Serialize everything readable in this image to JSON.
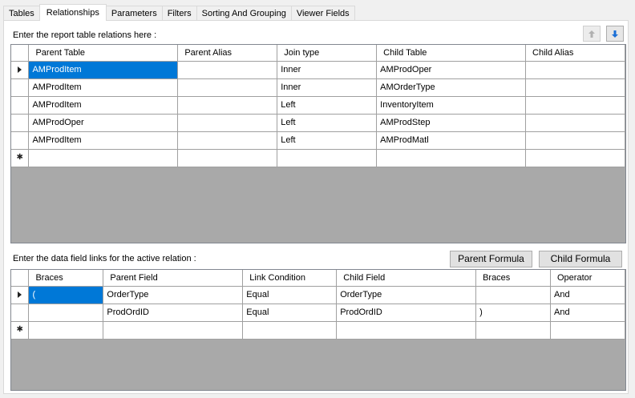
{
  "tabs": [
    "Tables",
    "Relationships",
    "Parameters",
    "Filters",
    "Sorting And Grouping",
    "Viewer Fields"
  ],
  "active_tab": "Relationships",
  "relations": {
    "label": "Enter the report table relations here :",
    "columns": [
      "Parent Table",
      "Parent Alias",
      "Join type",
      "Child Table",
      "Child Alias"
    ],
    "rows": [
      [
        "AMProdItem",
        "",
        "Inner",
        "AMProdOper",
        ""
      ],
      [
        "AMProdItem",
        "",
        "Inner",
        "AMOrderType",
        ""
      ],
      [
        "AMProdItem",
        "",
        "Left",
        "InventoryItem",
        ""
      ],
      [
        "AMProdOper",
        "",
        "Left",
        "AMProdStep",
        ""
      ],
      [
        "AMProdItem",
        "",
        "Left",
        "AMProdMatl",
        ""
      ]
    ],
    "up_icon": "arrow-up-icon",
    "down_icon": "arrow-down-icon"
  },
  "links": {
    "label": "Enter the data field links for the active relation :",
    "parent_formula_label": "Parent Formula",
    "child_formula_label": "Child Formula",
    "columns": [
      "Braces",
      "Parent Field",
      "Link Condition",
      "Child Field",
      "Braces",
      "Operator"
    ],
    "rows": [
      [
        "(",
        "OrderType",
        "Equal",
        "OrderType",
        "",
        "And"
      ],
      [
        "",
        "ProdOrdID",
        "Equal",
        "ProdOrdID",
        ")",
        "And"
      ]
    ]
  },
  "colors": {
    "selection": "#0078d7",
    "grid_empty": "#a9a9a9",
    "accent_arrow": "#1a6fd6"
  }
}
